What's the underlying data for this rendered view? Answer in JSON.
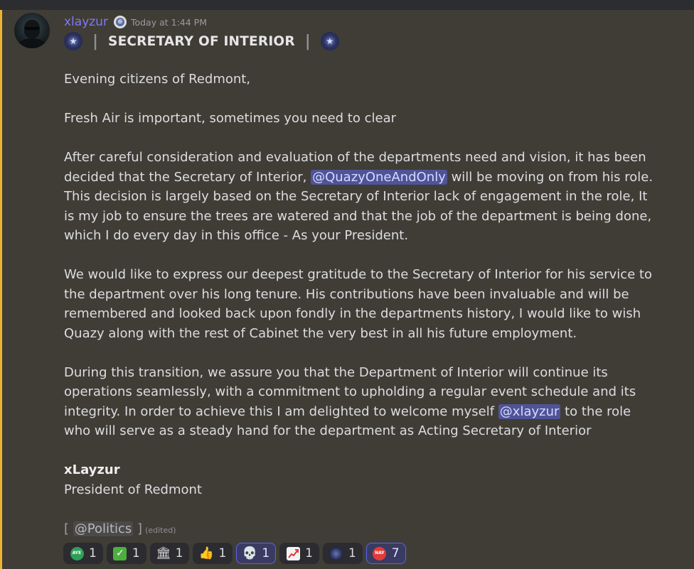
{
  "message": {
    "author": "xlayzur",
    "timestamp": "Today at 1:44 PM",
    "title": "SECRETARY OF INTERIOR",
    "title_separator": "|",
    "paragraphs": {
      "p1": "Evening citizens of Redmont,",
      "p2": "Fresh Air is important, sometimes you need to clear",
      "p3_a": "After careful consideration and evaluation of the departments need and vision, it has been decided that the Secretary of Interior, ",
      "p3_mention": "@QuazyOneAndOnly",
      "p3_b": " will be moving on from his role. This decision is largely based on the Secretary of Interior lack of engagement in the role, It is my job to ensure the trees are watered and that the job of the department is being done, which I do every day in this office - As your President.",
      "p4": "We would like to express our deepest gratitude to the Secretary of Interior for his service to the department over his long tenure. His contributions have been invaluable and will be remembered and looked back upon fondly in the departments history,  I would like to wish Quazy along with the rest of Cabinet the very best in all his future employment.",
      "p5_a": "During this transition, we assure you that the Department of Interior will continue its operations seamlessly, with a commitment to upholding a regular event schedule and its integrity. In order to achieve this I am delighted to welcome myself ",
      "p5_mention": "@xlayzur",
      "p5_b": " to the role who will serve as a steady hand for the department as Acting Secretary of Interior"
    },
    "signature_name": "xLayzur",
    "signature_title": "President of Redmont",
    "role_open": "[ ",
    "role_mention": "@Politics",
    "role_close": " ]",
    "edited_label": "(edited)"
  },
  "reactions": [
    {
      "icon": "aye-icon",
      "label": "AYE",
      "count": "1"
    },
    {
      "icon": "check-mark-icon",
      "label": "✓",
      "count": "1"
    },
    {
      "icon": "classical-building-icon",
      "label": "🏛",
      "count": "1"
    },
    {
      "icon": "thumbs-up-icon",
      "label": "👍",
      "count": "1"
    },
    {
      "icon": "skull-icon",
      "label": "💀",
      "count": "1"
    },
    {
      "icon": "chart-increasing-icon",
      "label": "",
      "count": "1"
    },
    {
      "icon": "seal-icon",
      "label": "",
      "count": "1"
    },
    {
      "icon": "nay-icon",
      "label": "NAY",
      "count": "7"
    }
  ],
  "colors": {
    "accent_bar": "#f0b232",
    "username": "#7e79f7",
    "mention_bg": "#4f5498",
    "reaction_active_border": "#5865f2"
  }
}
